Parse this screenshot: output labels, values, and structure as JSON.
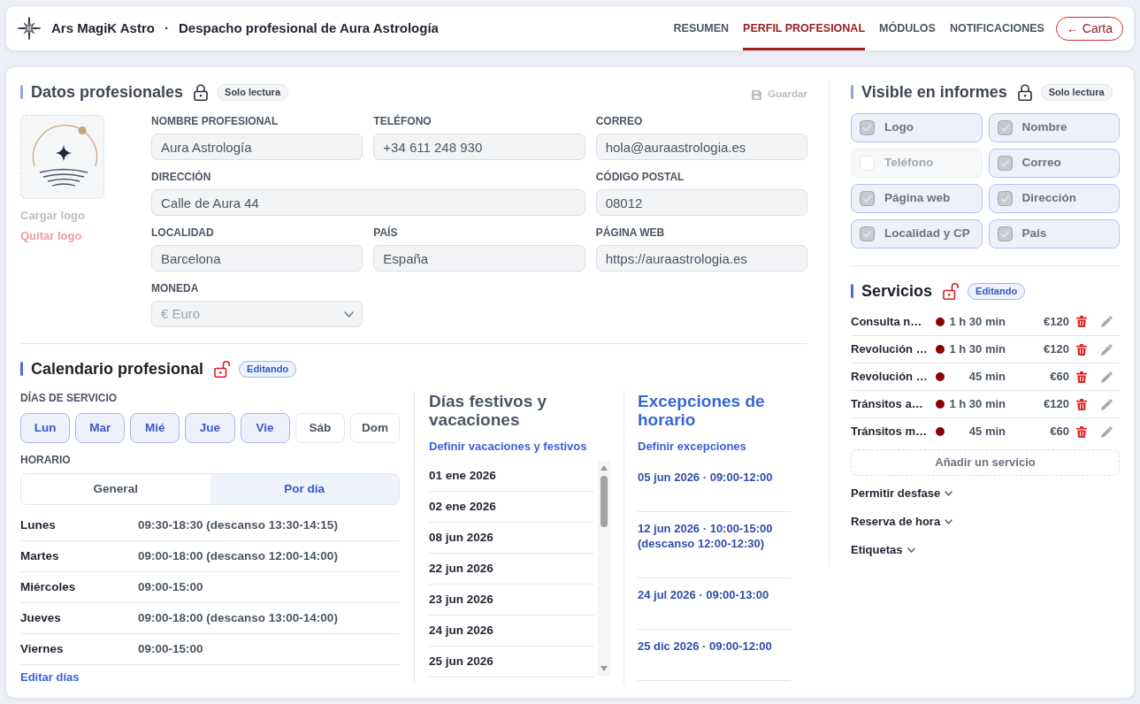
{
  "header": {
    "app_name": "Ars MagiK Astro",
    "separator": "·",
    "subtitle": "Despacho profesional de Aura Astrología",
    "tabs": [
      {
        "label": "RESUMEN",
        "selected": false
      },
      {
        "label": "PERFIL PROFESIONAL",
        "selected": true
      },
      {
        "label": "MÓDULOS",
        "selected": false
      },
      {
        "label": "NOTIFICACIONES",
        "selected": false
      }
    ],
    "back_button": "← Carta"
  },
  "professional_data": {
    "title": "Datos profesionales",
    "locked": true,
    "badge": "Solo lectura",
    "save_button": {
      "label": "Guardar",
      "disabled": true
    },
    "logo_actions": [
      {
        "label": "Cargar logo",
        "kind": "upload"
      },
      {
        "label": "Quitar logo",
        "kind": "remove"
      }
    ],
    "field_rows": [
      [
        {
          "label": "NOMBRE PROFESIONAL",
          "value": "Aura Astrología",
          "kind": "text",
          "disabled": false
        },
        {
          "label": "TELÉFONO",
          "value": "+34 611 248 930",
          "kind": "text",
          "disabled": false
        },
        {
          "label": "CORREO",
          "value": "hola@auraastrologia.es",
          "kind": "text",
          "disabled": false
        }
      ],
      [
        {
          "label": "DIRECCIÓN",
          "value": "Calle de Aura 44",
          "kind": "text",
          "disabled": false
        },
        {
          "label": "CÓDIGO POSTAL",
          "value": "08012",
          "kind": "text",
          "disabled": false
        }
      ],
      [
        {
          "label": "LOCALIDAD",
          "value": "Barcelona",
          "kind": "text",
          "disabled": false
        },
        {
          "label": "PAÍS",
          "value": "España",
          "kind": "text",
          "disabled": false
        },
        {
          "label": "PÁGINA WEB",
          "value": "https://auraastrologia.es",
          "kind": "text",
          "disabled": false
        }
      ],
      [
        {
          "label": "MONEDA",
          "value": "€ Euro",
          "kind": "select",
          "disabled": true
        }
      ]
    ]
  },
  "calendar": {
    "title": "Calendario profesional",
    "locked": false,
    "badge": "Editando",
    "service_days_label": "DÍAS DE SERVICIO",
    "days": [
      {
        "label": "Lun",
        "selected": true
      },
      {
        "label": "Mar",
        "selected": true
      },
      {
        "label": "Mié",
        "selected": true
      },
      {
        "label": "Jue",
        "selected": true
      },
      {
        "label": "Vie",
        "selected": true
      },
      {
        "label": "Sáb",
        "selected": false
      },
      {
        "label": "Dom",
        "selected": false
      }
    ],
    "schedule_label": "HORARIO",
    "schedule_modes": [
      {
        "label": "General",
        "selected": false
      },
      {
        "label": "Por día",
        "selected": true
      }
    ],
    "schedule": [
      {
        "day": "Lunes",
        "hours": "09:30-18:30 (descanso 13:30-14:15)"
      },
      {
        "day": "Martes",
        "hours": "09:00-18:00 (descanso 12:00-14:00)"
      },
      {
        "day": "Miércoles",
        "hours": "09:00-15:00"
      },
      {
        "day": "Jueves",
        "hours": "09:00-18:00 (descanso 13:00-14:00)"
      },
      {
        "day": "Viernes",
        "hours": "09:00-15:00"
      }
    ],
    "edit_link": "Editar días",
    "holidays": {
      "title": "Días festivos y vacaciones",
      "highlighted": false,
      "link": "Definir vacaciones y festivos",
      "items": [
        "01 ene 2026",
        "02 ene 2026",
        "08 jun 2026",
        "22 jun 2026",
        "23 jun 2026",
        "24 jun 2026",
        "25 jun 2026"
      ]
    },
    "exceptions": {
      "title": "Excepciones de horario",
      "highlighted": true,
      "link": "Definir excepciones",
      "items": [
        "05 jun 2026 · 09:00-12:00",
        "12 jun 2026 · 10:00-15:00 (descanso 12:00-12:30)",
        "24 jul 2026 · 09:00-13:00",
        "25 dic 2026 · 09:00-12:00"
      ]
    }
  },
  "report_visibility": {
    "title": "Visible en informes",
    "locked": true,
    "badge": "Solo lectura",
    "options": [
      {
        "label": "Logo",
        "checked": true
      },
      {
        "label": "Nombre",
        "checked": true
      },
      {
        "label": "Teléfono",
        "checked": false
      },
      {
        "label": "Correo",
        "checked": true
      },
      {
        "label": "Página web",
        "checked": true
      },
      {
        "label": "Dirección",
        "checked": true
      },
      {
        "label": "Localidad y CP",
        "checked": true
      },
      {
        "label": "País",
        "checked": true
      }
    ]
  },
  "services": {
    "title": "Servicios",
    "locked": false,
    "badge": "Editando",
    "items": [
      {
        "name": "Consulta n…",
        "color": "#8b0000",
        "duration": "1 h 30 min",
        "price": "€120"
      },
      {
        "name": "Revolución …",
        "color": "#8b0000",
        "duration": "1 h 30 min",
        "price": "€120"
      },
      {
        "name": "Revolución …",
        "color": "#8b0000",
        "duration": "45 min",
        "price": "€60"
      },
      {
        "name": "Tránsitos a…",
        "color": "#8b0000",
        "duration": "1 h 30 min",
        "price": "€120"
      },
      {
        "name": "Tránsitos m…",
        "color": "#8b0000",
        "duration": "45 min",
        "price": "€60"
      }
    ],
    "add_button": "Añadir un servicio",
    "sections": [
      {
        "label": "Permitir desfase",
        "expanded": false
      },
      {
        "label": "Reserva de hora",
        "expanded": false
      },
      {
        "label": "Etiquetas",
        "expanded": false
      }
    ]
  }
}
